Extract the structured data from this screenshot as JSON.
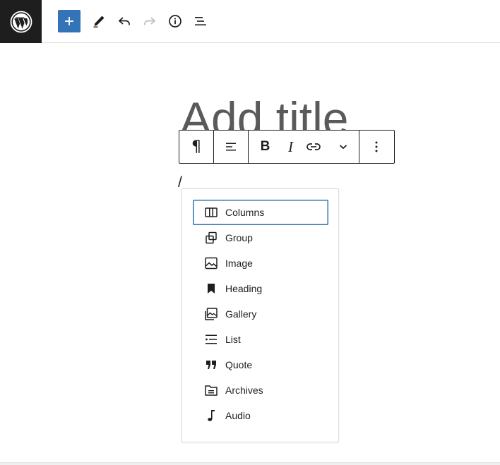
{
  "header": {
    "logo_icon": "wordpress-logo",
    "buttons": [
      {
        "name": "add-block",
        "icon": "plus-icon",
        "color": "#3373b7"
      },
      {
        "name": "tools",
        "icon": "pencil-icon"
      },
      {
        "name": "undo",
        "icon": "undo-icon"
      },
      {
        "name": "redo",
        "icon": "redo-icon",
        "disabled": true
      },
      {
        "name": "details",
        "icon": "info-icon"
      },
      {
        "name": "list-view",
        "icon": "list-view-icon"
      }
    ]
  },
  "editor": {
    "title_placeholder": "Add title",
    "paragraph_text": "/"
  },
  "block_toolbar": {
    "paragraph_icon": "¶",
    "align_icon": "align-left-icon",
    "bold_label": "B",
    "italic_label": "I",
    "link_icon": "link-icon",
    "more_icon": "chevron-down-icon",
    "options_icon": "more-vertical-icon"
  },
  "slash_menu": {
    "selected_index": 0,
    "items": [
      {
        "label": "Columns",
        "icon": "columns-icon"
      },
      {
        "label": "Group",
        "icon": "group-icon"
      },
      {
        "label": "Image",
        "icon": "image-icon"
      },
      {
        "label": "Heading",
        "icon": "heading-icon"
      },
      {
        "label": "Gallery",
        "icon": "gallery-icon"
      },
      {
        "label": "List",
        "icon": "list-icon"
      },
      {
        "label": "Quote",
        "icon": "quote-icon"
      },
      {
        "label": "Archives",
        "icon": "archives-icon"
      },
      {
        "label": "Audio",
        "icon": "audio-icon"
      }
    ]
  },
  "colors": {
    "accent": "#3373b7",
    "logo_bg": "#1e1e1e",
    "text": "#1e1e1e"
  }
}
